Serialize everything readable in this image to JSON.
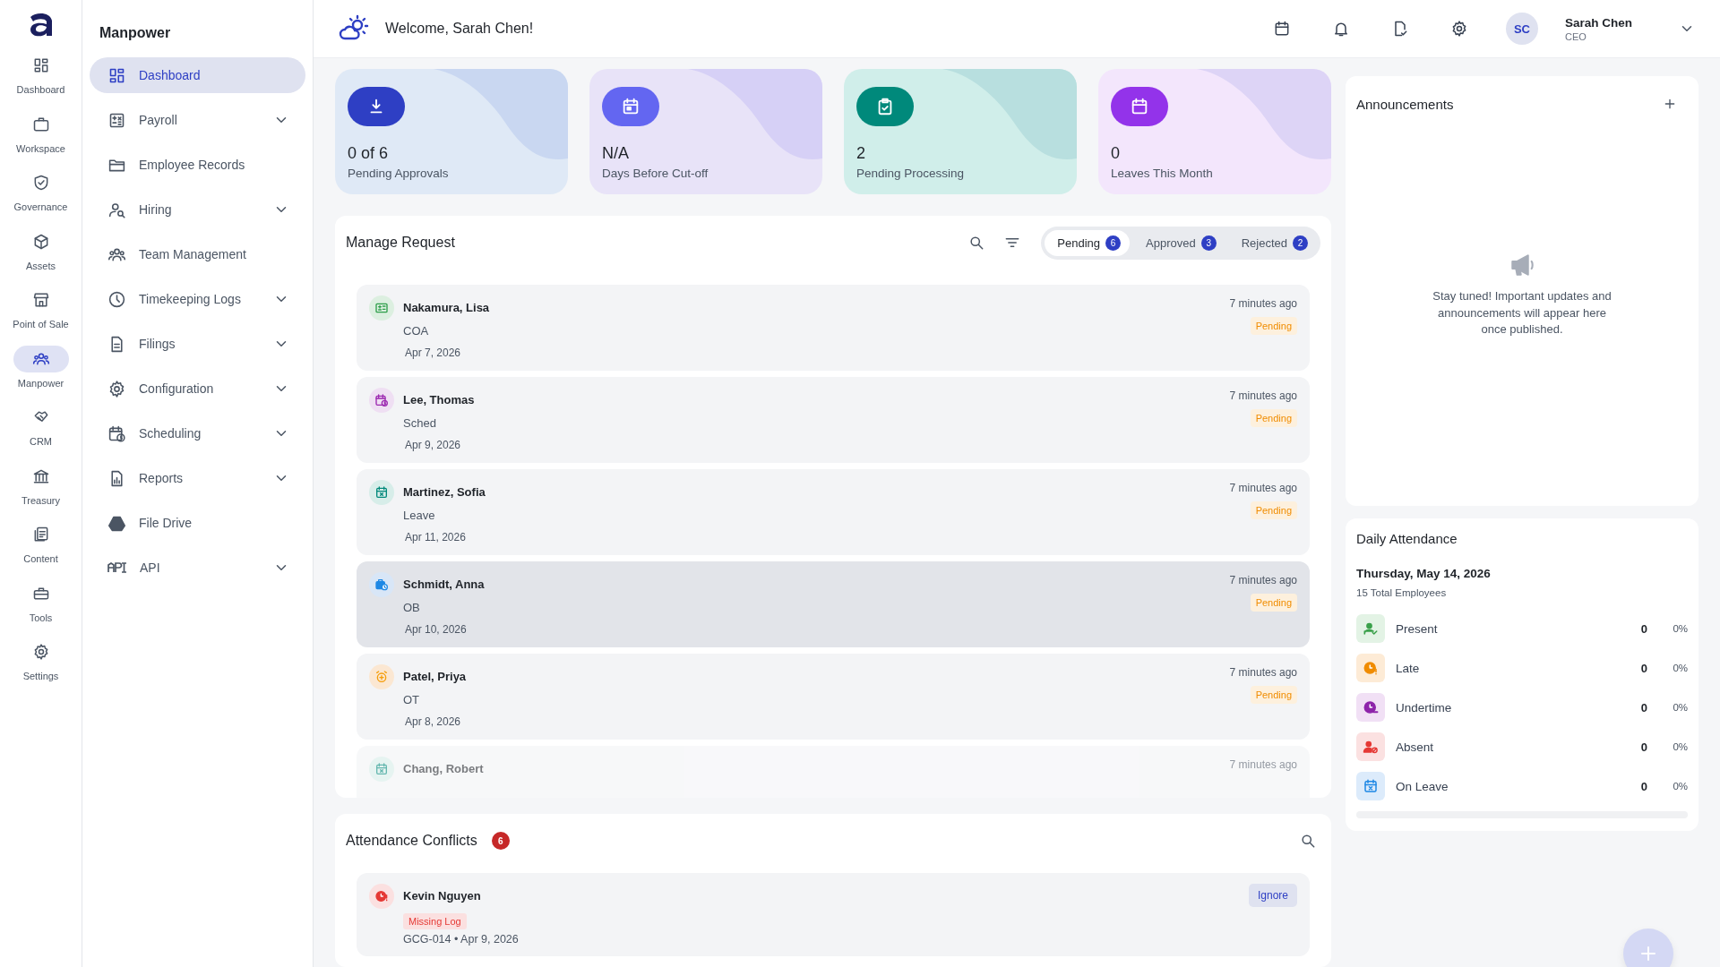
{
  "rail": [
    {
      "label": "Dashboard",
      "selected": false
    },
    {
      "label": "Workspace",
      "selected": false
    },
    {
      "label": "Governance",
      "selected": false
    },
    {
      "label": "Assets",
      "selected": false
    },
    {
      "label": "Point of Sale",
      "selected": false
    },
    {
      "label": "Manpower",
      "selected": true
    },
    {
      "label": "CRM",
      "selected": false
    },
    {
      "label": "Treasury",
      "selected": false
    },
    {
      "label": "Content",
      "selected": false
    },
    {
      "label": "Tools",
      "selected": false
    },
    {
      "label": "Settings",
      "selected": false
    }
  ],
  "sidebar": {
    "title": "Manpower",
    "items": [
      {
        "label": "Dashboard",
        "selected": true,
        "expandable": false
      },
      {
        "label": "Payroll",
        "selected": false,
        "expandable": true
      },
      {
        "label": "Employee Records",
        "selected": false,
        "expandable": false
      },
      {
        "label": "Hiring",
        "selected": false,
        "expandable": true
      },
      {
        "label": "Team Management",
        "selected": false,
        "expandable": false
      },
      {
        "label": "Timekeeping Logs",
        "selected": false,
        "expandable": true
      },
      {
        "label": "Filings",
        "selected": false,
        "expandable": true
      },
      {
        "label": "Configuration",
        "selected": false,
        "expandable": true
      },
      {
        "label": "Scheduling",
        "selected": false,
        "expandable": true
      },
      {
        "label": "Reports",
        "selected": false,
        "expandable": true
      },
      {
        "label": "File Drive",
        "selected": false,
        "expandable": false
      },
      {
        "label": "API",
        "selected": false,
        "expandable": true
      }
    ]
  },
  "header": {
    "welcome": "Welcome, Sarah Chen!",
    "user": {
      "initials": "SC",
      "name": "Sarah Chen",
      "role": "CEO"
    }
  },
  "stats": [
    {
      "kind": "approvals",
      "value": "0 of 6",
      "label": "Pending Approvals"
    },
    {
      "kind": "cutoff",
      "value": "N/A",
      "label": "Days Before Cut-off"
    },
    {
      "kind": "processing",
      "value": "2",
      "label": "Pending Processing"
    },
    {
      "kind": "leaves",
      "value": "0",
      "label": "Leaves This Month"
    }
  ],
  "manage_request": {
    "title": "Manage Request",
    "tabs": [
      {
        "label": "Pending",
        "count": "6",
        "selected": true
      },
      {
        "label": "Approved",
        "count": "3",
        "selected": false
      },
      {
        "label": "Rejected",
        "count": "2",
        "selected": false
      }
    ],
    "requests": [
      {
        "kind": "coa",
        "name": "Nakamura, Lisa",
        "type": "COA",
        "date": "Apr 7, 2026",
        "time": "7 minutes ago",
        "status": "Pending",
        "highlighted": false,
        "faded": false
      },
      {
        "kind": "sched",
        "name": "Lee, Thomas",
        "type": "Sched",
        "date": "Apr 9, 2026",
        "time": "7 minutes ago",
        "status": "Pending",
        "highlighted": false,
        "faded": false
      },
      {
        "kind": "leave",
        "name": "Martinez, Sofia",
        "type": "Leave",
        "date": "Apr 11, 2026",
        "time": "7 minutes ago",
        "status": "Pending",
        "highlighted": false,
        "faded": false
      },
      {
        "kind": "ob",
        "name": "Schmidt, Anna",
        "type": "OB",
        "date": "Apr 10, 2026",
        "time": "7 minutes ago",
        "status": "Pending",
        "highlighted": true,
        "faded": false
      },
      {
        "kind": "ot",
        "name": "Patel, Priya",
        "type": "OT",
        "date": "Apr 8, 2026",
        "time": "7 minutes ago",
        "status": "Pending",
        "highlighted": false,
        "faded": false
      },
      {
        "kind": "leave",
        "name": "Chang, Robert",
        "time": "7 minutes ago",
        "highlighted": false,
        "faded": true
      }
    ]
  },
  "conflicts": {
    "title": "Attendance Conflicts",
    "count": "6",
    "items": [
      {
        "name": "Kevin Nguyen",
        "tag": "Missing Log",
        "detail": "GCG-014 • Apr 9, 2026",
        "action": "Ignore"
      }
    ]
  },
  "announcements": {
    "title": "Announcements",
    "empty": "Stay tuned! Important updates and announcements will appear here once published."
  },
  "attendance": {
    "title": "Daily Attendance",
    "date": "Thursday, May 14, 2026",
    "total": "15 Total Employees",
    "rows": [
      {
        "kind": "present",
        "label": "Present",
        "count": "0",
        "percent": "0%"
      },
      {
        "kind": "late",
        "label": "Late",
        "count": "0",
        "percent": "0%"
      },
      {
        "kind": "undertime",
        "label": "Undertime",
        "count": "0",
        "percent": "0%"
      },
      {
        "kind": "absent",
        "label": "Absent",
        "count": "0",
        "percent": "0%"
      },
      {
        "kind": "leave",
        "label": "On Leave",
        "count": "0",
        "percent": "0%"
      }
    ]
  }
}
